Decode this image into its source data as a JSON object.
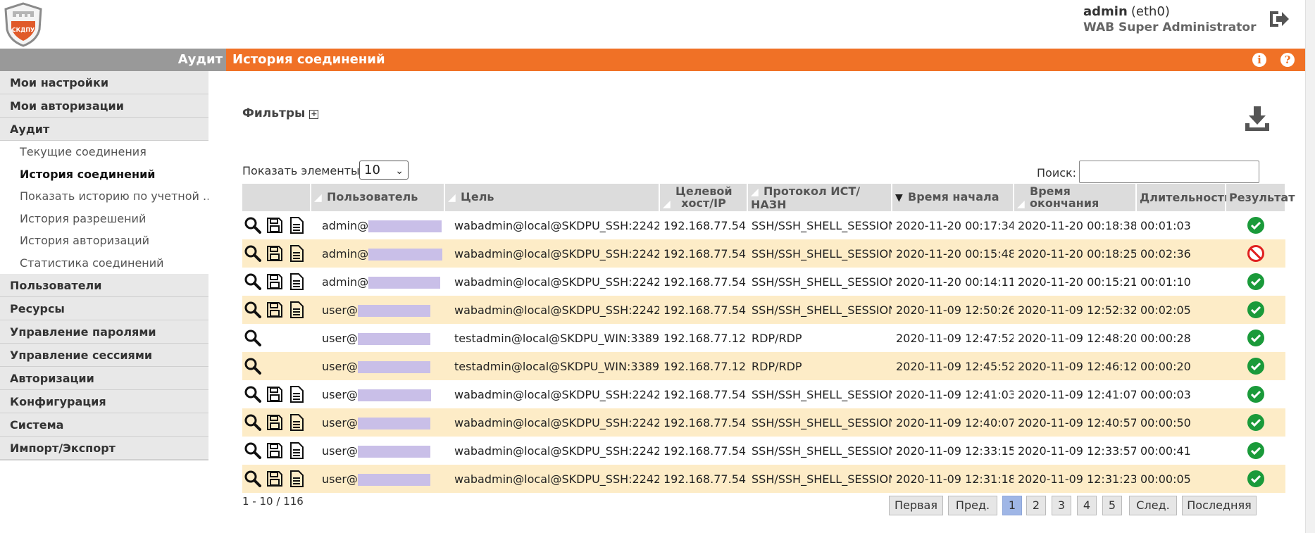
{
  "header": {
    "logo_text": "СКДПУ",
    "user_name": "admin",
    "user_iface": "(eth0)",
    "user_role": "WAB Super Administrator",
    "logout_icon": "logout-icon"
  },
  "topbar": {
    "section": "Аудит",
    "title": "История соединений",
    "info_label": "i",
    "help_label": "?"
  },
  "sidebar": {
    "groups": [
      {
        "label": "Мои настройки"
      },
      {
        "label": "Мои авторизации"
      },
      {
        "label": "Аудит",
        "items": [
          {
            "label": "Текущие соединения"
          },
          {
            "label": "История соединений",
            "active": true
          },
          {
            "label": "Показать историю по учетной ..."
          },
          {
            "label": "История разрешений"
          },
          {
            "label": "История авторизаций"
          },
          {
            "label": "Статистика соединений"
          }
        ]
      },
      {
        "label": "Пользователи"
      },
      {
        "label": "Ресурсы"
      },
      {
        "label": "Управление паролями"
      },
      {
        "label": "Управление сессиями"
      },
      {
        "label": "Авторизации"
      },
      {
        "label": "Конфигурация"
      },
      {
        "label": "Система"
      },
      {
        "label": "Импорт/Экспорт"
      }
    ]
  },
  "main": {
    "filters_label": "Фильтры",
    "filters_toggle": "+",
    "show_label": "Показать элементы",
    "show_value": "10",
    "search_label": "Поиск:",
    "search_value": "",
    "columns": [
      {
        "label": ""
      },
      {
        "label": "Пользователь"
      },
      {
        "label": "Цель"
      },
      {
        "label": "Целевой хост/IP"
      },
      {
        "label": "Протокол ИСТ/НАЗН"
      },
      {
        "label": "Время начала"
      },
      {
        "label": "Время окончания"
      },
      {
        "label": "Длительность"
      },
      {
        "label": "Результат"
      }
    ],
    "rows": [
      {
        "icons": [
          "search-icon",
          "save-icon",
          "document-icon"
        ],
        "user": "admin@",
        "target": "wabadmin@local@SKDPU_SSH:2242",
        "host": "192.168.77.54",
        "protocol": "SSH/SSH_SHELL_SESSION",
        "start": "2020-11-20 00:17:34",
        "end": "2020-11-20 00:18:38",
        "duration": "00:01:03",
        "result": "ok"
      },
      {
        "icons": [
          "search-icon",
          "save-icon",
          "document-icon"
        ],
        "user": "admin@",
        "target": "wabadmin@local@SKDPU_SSH:2242",
        "host": "192.168.77.54",
        "protocol": "SSH/SSH_SHELL_SESSION",
        "start": "2020-11-20 00:15:48",
        "end": "2020-11-20 00:18:25",
        "duration": "00:02:36",
        "result": "fail"
      },
      {
        "icons": [
          "search-icon",
          "save-icon",
          "document-icon"
        ],
        "user": "admin@",
        "target": "wabadmin@local@SKDPU_SSH:2242",
        "host": "192.168.77.54",
        "protocol": "SSH/SSH_SHELL_SESSION",
        "start": "2020-11-20 00:14:11",
        "end": "2020-11-20 00:15:21",
        "duration": "00:01:10",
        "result": "ok"
      },
      {
        "icons": [
          "search-icon",
          "save-icon",
          "document-icon"
        ],
        "user": "user@",
        "target": "wabadmin@local@SKDPU_SSH:2242",
        "host": "192.168.77.54",
        "protocol": "SSH/SSH_SHELL_SESSION",
        "start": "2020-11-09 12:50:26",
        "end": "2020-11-09 12:52:32",
        "duration": "00:02:05",
        "result": "ok"
      },
      {
        "icons": [
          "search-icon"
        ],
        "user": "user@",
        "target": "testadmin@local@SKDPU_WIN:3389",
        "host": "192.168.77.12",
        "protocol": "RDP/RDP",
        "start": "2020-11-09 12:47:52",
        "end": "2020-11-09 12:48:20",
        "duration": "00:00:28",
        "result": "ok"
      },
      {
        "icons": [
          "search-icon"
        ],
        "user": "user@",
        "target": "testadmin@local@SKDPU_WIN:3389",
        "host": "192.168.77.12",
        "protocol": "RDP/RDP",
        "start": "2020-11-09 12:45:52",
        "end": "2020-11-09 12:46:12",
        "duration": "00:00:20",
        "result": "ok"
      },
      {
        "icons": [
          "search-icon",
          "save-icon",
          "document-icon"
        ],
        "user": "user@",
        "target": "wabadmin@local@SKDPU_SSH:2242",
        "host": "192.168.77.54",
        "protocol": "SSH/SSH_SHELL_SESSION",
        "start": "2020-11-09 12:41:03",
        "end": "2020-11-09 12:41:07",
        "duration": "00:00:03",
        "result": "ok"
      },
      {
        "icons": [
          "search-icon",
          "save-icon",
          "document-icon"
        ],
        "user": "user@",
        "target": "wabadmin@local@SKDPU_SSH:2242",
        "host": "192.168.77.54",
        "protocol": "SSH/SSH_SHELL_SESSION",
        "start": "2020-11-09 12:40:07",
        "end": "2020-11-09 12:40:57",
        "duration": "00:00:50",
        "result": "ok"
      },
      {
        "icons": [
          "search-icon",
          "save-icon",
          "document-icon"
        ],
        "user": "user@",
        "target": "wabadmin@local@SKDPU_SSH:2242",
        "host": "192.168.77.54",
        "protocol": "SSH/SSH_SHELL_SESSION",
        "start": "2020-11-09 12:33:15",
        "end": "2020-11-09 12:33:57",
        "duration": "00:00:41",
        "result": "ok"
      },
      {
        "icons": [
          "search-icon",
          "save-icon",
          "document-icon"
        ],
        "user": "user@",
        "target": "wabadmin@local@SKDPU_SSH:2242",
        "host": "192.168.77.54",
        "protocol": "SSH/SSH_SHELL_SESSION",
        "start": "2020-11-09 12:31:18",
        "end": "2020-11-09 12:31:23",
        "duration": "00:00:05",
        "result": "ok"
      }
    ],
    "count_text": "1 - 10 / 116",
    "pagination": [
      {
        "label": "Первая"
      },
      {
        "label": "Пред."
      },
      {
        "label": "1",
        "current": true
      },
      {
        "label": "2"
      },
      {
        "label": "3"
      },
      {
        "label": "4"
      },
      {
        "label": "5"
      },
      {
        "label": "След."
      },
      {
        "label": "Последняя"
      }
    ]
  },
  "colors": {
    "accent": "#f07126",
    "row_alt": "#fdecc7",
    "ok": "#1a9a3a",
    "fail": "#e02020",
    "page_current": "#9fb6e6"
  }
}
